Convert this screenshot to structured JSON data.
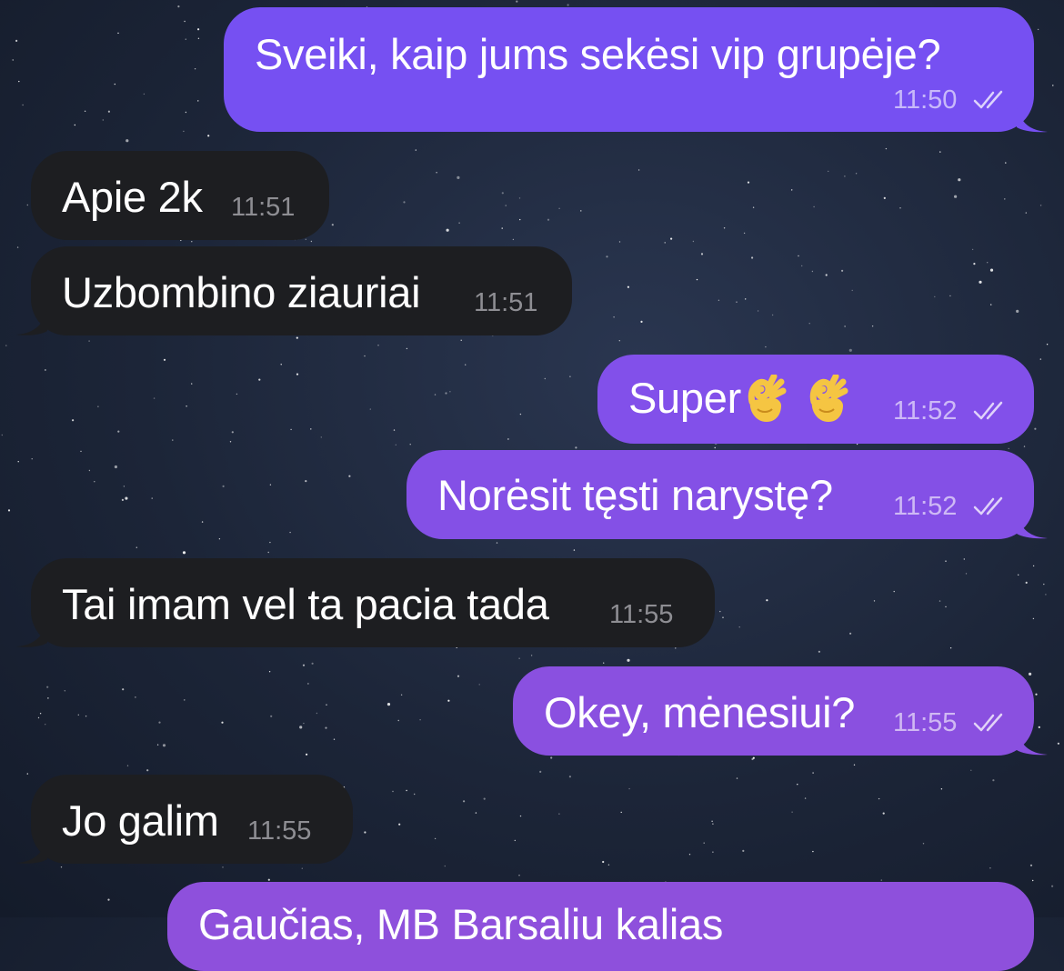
{
  "theme": {
    "outgoing_top": "#7a4df3",
    "outgoing_bottom": "#8b4fe0",
    "incoming": "#1d1e21",
    "background": "#1c2538"
  },
  "messages": [
    {
      "direction": "outgoing",
      "text": "Sveiki, kaip jums sekėsi vip grupėje?",
      "time": "11:50",
      "status": "read"
    },
    {
      "direction": "incoming",
      "text": "Apie 2k",
      "time": "11:51"
    },
    {
      "direction": "incoming",
      "text": "Uzbombino ziauriai",
      "time": "11:51"
    },
    {
      "direction": "outgoing",
      "text": "Super",
      "emoji": [
        "ok-hand-emoji",
        "ok-hand-emoji"
      ],
      "time": "11:52",
      "status": "read"
    },
    {
      "direction": "outgoing",
      "text": "Norėsit tęsti narystę?",
      "time": "11:52",
      "status": "read"
    },
    {
      "direction": "incoming",
      "text": "Tai imam vel ta pacia tada",
      "time": "11:55"
    },
    {
      "direction": "outgoing",
      "text": "Okey, mėnesiui?",
      "time": "11:55",
      "status": "read"
    },
    {
      "direction": "incoming",
      "text": "Jo galim",
      "time": "11:55"
    },
    {
      "direction": "outgoing",
      "text": "Gaučias, MB Barsaliu kalias",
      "time": "",
      "status": "partial"
    }
  ]
}
